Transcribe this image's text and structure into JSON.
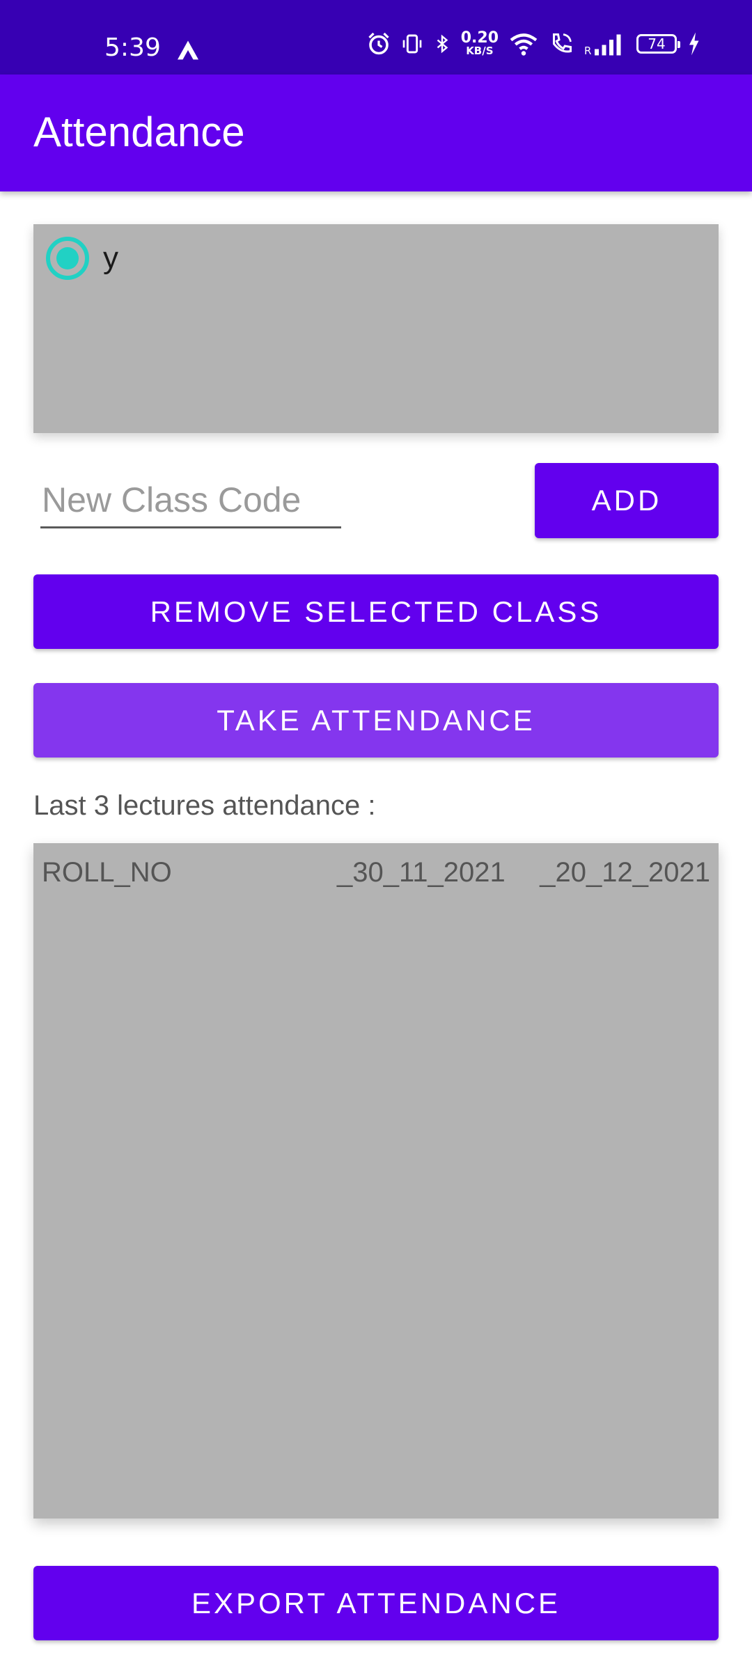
{
  "status_bar": {
    "time": "5:39",
    "net_speed_value": "0.20",
    "net_speed_unit": "KB/S",
    "battery_level": "74",
    "icons": [
      "app-notification-icon",
      "alarm-icon",
      "vibrate-icon",
      "bluetooth-icon",
      "wifi-icon",
      "wifi-calling-icon",
      "signal-icon",
      "battery-icon",
      "charging-icon"
    ]
  },
  "app_bar": {
    "title": "Attendance"
  },
  "class_list": {
    "items": [
      {
        "label": "y",
        "selected": true
      }
    ],
    "accent_color": "#21d1c4"
  },
  "new_class": {
    "placeholder": "New Class Code",
    "value": ""
  },
  "buttons": {
    "add": "ADD",
    "remove": "REMOVE SELECTED CLASS",
    "take": "TAKE ATTENDANCE",
    "export": "EXPORT ATTENDANCE"
  },
  "attendance": {
    "section_label": "Last 3 lectures attendance :",
    "columns": [
      "ROLL_NO",
      "_30_11_2021",
      "_20_12_2021"
    ],
    "rows": []
  },
  "colors": {
    "primary": "#6200ee",
    "primary_dark": "#3700b3",
    "take_button": "#8436ee",
    "panel": "#b3b3b3"
  }
}
